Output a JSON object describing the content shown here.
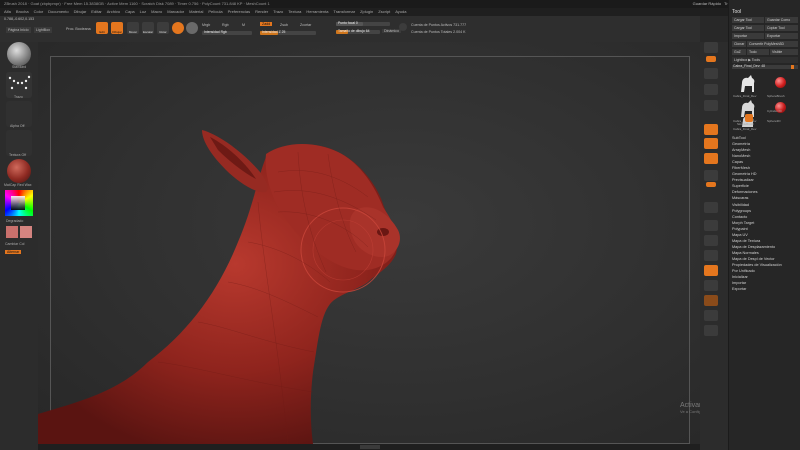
{
  "titlebar": {
    "title": "ZBrush 2018 · Goat (zbpbpmpr) · Free Mem 15.3838GB · Active Mem 1160 · Scratch Disk 7089 · Timer 0.756 · PolyCount 731.848 KP · MeshCount 1",
    "quick_save": "Guardar Rápido",
    "transparency": "Transparencia 0",
    "menu_btn": "Menú",
    "script": "ZScript Prest"
  },
  "menus": [
    "Alfa",
    "Brocha",
    "Color",
    "Documento",
    "Dibujar",
    "Editar",
    "Archivo",
    "Capa",
    "Luz",
    "Macro",
    "Marcador",
    "Material",
    "Película",
    "Preferencias",
    "Render",
    "Trazo",
    "Textura",
    "Herramienta",
    "Transformar",
    "Zplugin",
    "Zscript",
    "Ayuda"
  ],
  "toolbar": {
    "coords": "0.788,-0.602,0.153",
    "home_page": "Página Inicio",
    "lightbox": "LightBox",
    "live_boolean": "Proc. Booleana",
    "edit": "Edit",
    "draw": "Dibujar",
    "move": "Mover",
    "scale": "Escalar",
    "rotate": "Rotar",
    "mrgb": "Mrgb",
    "rgb": "Rgb",
    "m": "M",
    "zadd": "Zadd",
    "zsub": "Zsub",
    "zcut": "Zcortar",
    "rgb_intensity": "Intensidad Rgb",
    "z_intensity": "Intensidad Z 25",
    "focal_shift": "Punto focal 0",
    "draw_size": "Tamaño de dibujo 64",
    "dynamic": "Dinámico",
    "active_points": "Cuenta de Puntos Activos 731.777",
    "total_points": "Cuenta de Puntos Totales 2.004 K"
  },
  "leftshelf": {
    "brush_label": "Standard",
    "stroke_label": "Trazo",
    "alpha_label": "Alpha Off",
    "texture_label": "Textura Off",
    "material_label": "MatCap Red Wax",
    "gradient_label": "Degradado",
    "switch_color": "Cambiar Col",
    "alternate": "Alternar"
  },
  "panel": {
    "title": "Tool",
    "load_tool": "Cargar Tool",
    "save_as": "Guardar Como",
    "load_project": "Cargar Tool",
    "copy_tool": "Copiar Tool",
    "import": "Importar",
    "export": "Exportar",
    "clone": "Clonar",
    "make_polymesh": "Convertir PolyMesh3D",
    "goz": "GoZ",
    "all": "Todo",
    "visible": "Visible",
    "lightbox_tools": "Lightbox ▶ Tools",
    "goat_label": "Cabra_Final_Dev: 48",
    "t1": "Cabra_Final_Dev",
    "t2": "SphereBrush",
    "t3": "Cabra_Final_Dev",
    "t4": "Sphere3D",
    "t5": "Cabra_Final_Dev",
    "t6": "Cylinder3D",
    "t7": "SimpleBrush",
    "items": [
      "SubTool",
      "Geometría",
      "ArrayMesh",
      "NanoMesh",
      "Capas",
      "FiberMesh",
      "Geometría HD",
      "Previsualizar",
      "Superficie",
      "Deformaciones",
      "Máscaras",
      "Visibilidad",
      "Polygroups",
      "Contacto",
      "Morph Target",
      "Polypaint",
      "Mapa UV",
      "Mapa de Textura",
      "Mapa de Desplazamiento",
      "Mapa Normales",
      "Mapa de Despl de Vector",
      "Propiedades de Visualización",
      "Por Unificado",
      "Inicializar",
      "Importar",
      "Exportar"
    ]
  },
  "watermark": {
    "line1": "Activar Windows",
    "line2": "Ve a Configuración para activar Windows."
  },
  "colors": {
    "accent": "#e4761e",
    "wax": "#9b2a23",
    "background": "#303030"
  }
}
